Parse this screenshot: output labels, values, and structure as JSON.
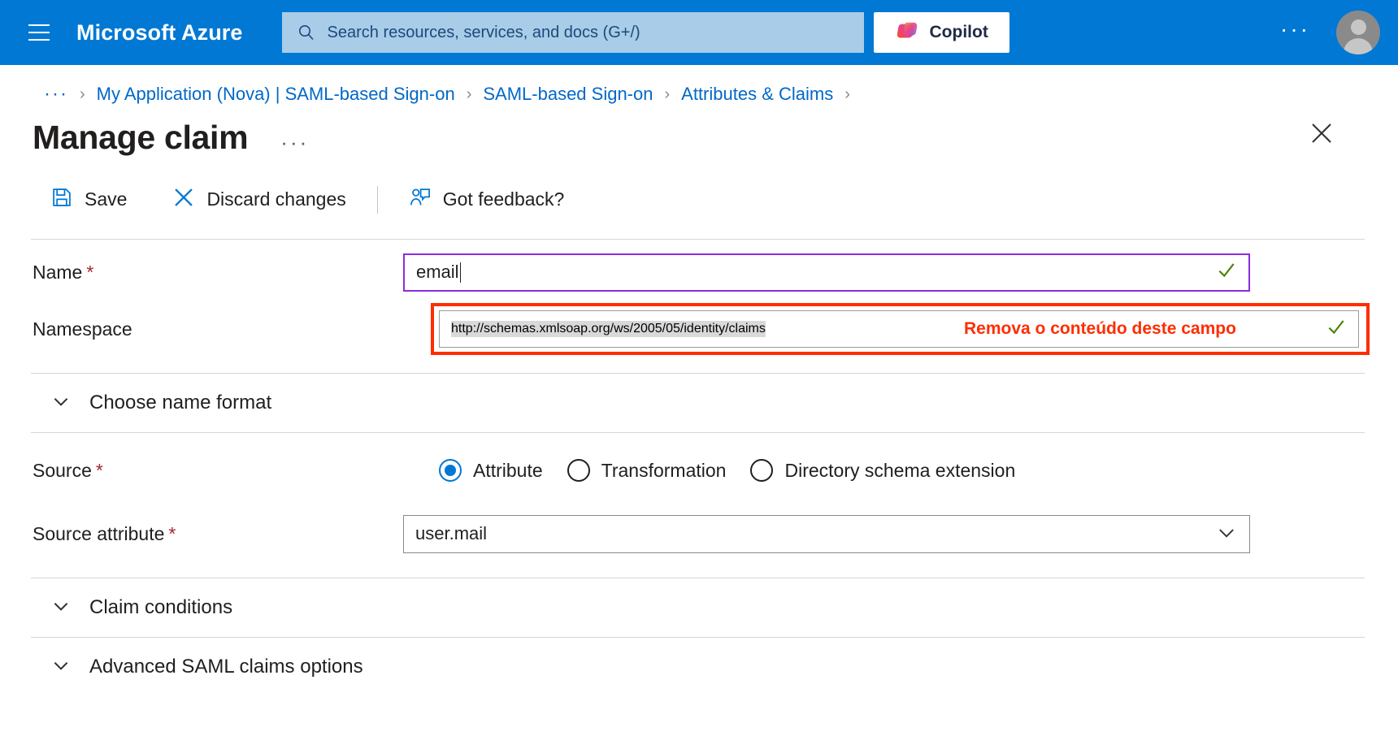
{
  "topbar": {
    "menu_icon": "hamburger-icon",
    "brand": "Microsoft Azure",
    "search_placeholder": "Search resources, services, and docs (G+/)",
    "search_value": "",
    "search_icon": "search-icon",
    "copilot_label": "Copilot",
    "copilot_icon": "copilot-icon",
    "more_label": "···",
    "avatar_icon": "user-avatar-icon"
  },
  "breadcrumb": {
    "overflow": "···",
    "separator": "›",
    "items": [
      {
        "label": "My Application (Nova) | SAML-based Sign-on"
      },
      {
        "label": "SAML-based Sign-on"
      },
      {
        "label": "Attributes & Claims"
      }
    ]
  },
  "header": {
    "title": "Manage claim",
    "more_label": "···",
    "close_icon": "close-icon"
  },
  "toolbar": {
    "save_label": "Save",
    "save_icon": "save-icon",
    "discard_label": "Discard changes",
    "discard_icon": "close-x-icon",
    "feedback_label": "Got feedback?",
    "feedback_icon": "feedback-person-icon"
  },
  "form": {
    "name": {
      "label": "Name",
      "required_marker": "*",
      "value": "email",
      "valid_icon": "checkmark-icon"
    },
    "namespace": {
      "label": "Namespace",
      "value": "http://schemas.xmlsoap.org/ws/2005/05/identity/claims",
      "annotation": "Remova o conteúdo deste campo",
      "annotation_color": "#FF2D00",
      "highlight_color": "#FF2D00",
      "valid_icon": "checkmark-icon"
    },
    "choose_name_format": {
      "label": "Choose name format",
      "chevron_icon": "chevron-down-icon",
      "expanded": false
    },
    "source": {
      "label": "Source",
      "required_marker": "*",
      "options": [
        {
          "label": "Attribute",
          "selected": true
        },
        {
          "label": "Transformation",
          "selected": false
        },
        {
          "label": "Directory schema extension",
          "selected": false
        }
      ]
    },
    "source_attribute": {
      "label": "Source attribute",
      "required_marker": "*",
      "value": "user.mail",
      "chevron_icon": "chevron-down-icon"
    },
    "claim_conditions": {
      "label": "Claim conditions",
      "chevron_icon": "chevron-down-icon",
      "expanded": false
    },
    "advanced_saml": {
      "label": "Advanced SAML claims options",
      "chevron_icon": "chevron-down-icon",
      "expanded": false
    }
  },
  "colors": {
    "azure_blue": "#0078D4",
    "link_blue": "#0068C9",
    "focus_purple": "#8A2BE2",
    "required_red": "#a4262c",
    "valid_green": "#498205",
    "alert_red": "#FF2D00"
  }
}
